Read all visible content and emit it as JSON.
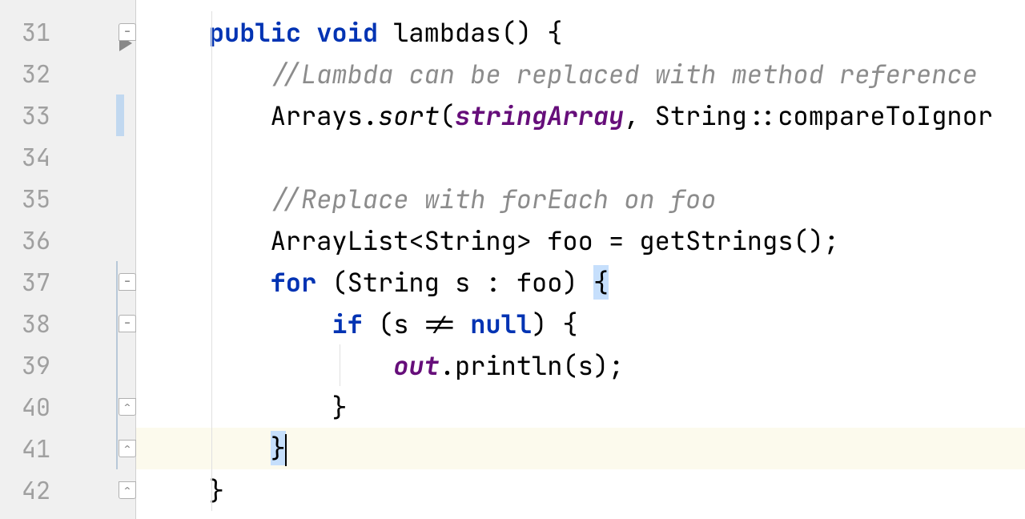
{
  "editor": {
    "startLine": 31,
    "currentLine": 41,
    "lines": [
      {
        "num": 31,
        "foldTop": true,
        "runMarker": true,
        "indent": "    ",
        "tokens": [
          {
            "t": "public",
            "c": "kw"
          },
          {
            "t": " ",
            "c": ""
          },
          {
            "t": "void",
            "c": "kw"
          },
          {
            "t": " ",
            "c": ""
          },
          {
            "t": "lambdas",
            "c": "method-decl"
          },
          {
            "t": "() {",
            "c": "paren"
          }
        ]
      },
      {
        "num": 32,
        "indent": "        ",
        "tokens": [
          {
            "t": "//Lambda can be replaced with method reference",
            "c": "comment"
          }
        ]
      },
      {
        "num": 33,
        "changeMarker": true,
        "indent": "        ",
        "tokens": [
          {
            "t": "Arrays.",
            "c": "ident"
          },
          {
            "t": "sort",
            "c": "static-method"
          },
          {
            "t": "(",
            "c": "paren"
          },
          {
            "t": "stringArray",
            "c": "field"
          },
          {
            "t": ", String::compareToIgnor",
            "c": "ident"
          }
        ]
      },
      {
        "num": 34,
        "indent": "",
        "tokens": []
      },
      {
        "num": 35,
        "indent": "        ",
        "tokens": [
          {
            "t": "//Replace with forEach on foo",
            "c": "comment"
          }
        ]
      },
      {
        "num": 36,
        "indent": "        ",
        "tokens": [
          {
            "t": "ArrayList<String> foo = getStrings();",
            "c": "ident"
          }
        ]
      },
      {
        "num": 37,
        "foldTop": true,
        "vline": true,
        "indent": "        ",
        "tokens": [
          {
            "t": "for",
            "c": "kw"
          },
          {
            "t": " (String s : foo) ",
            "c": "ident"
          },
          {
            "t": "{",
            "c": "highlight-brace"
          }
        ]
      },
      {
        "num": 38,
        "foldTop": true,
        "vline": true,
        "indent": "            ",
        "tokens": [
          {
            "t": "if",
            "c": "kw"
          },
          {
            "t": " (s != ",
            "c": "ident"
          },
          {
            "t": "null",
            "c": "kw"
          },
          {
            "t": ") {",
            "c": "ident"
          }
        ]
      },
      {
        "num": 39,
        "vline": true,
        "indent": "                ",
        "tokens": [
          {
            "t": "out",
            "c": "field"
          },
          {
            "t": ".println(s);",
            "c": "ident"
          }
        ]
      },
      {
        "num": 40,
        "foldBottom": true,
        "vline": true,
        "indent": "            ",
        "tokens": [
          {
            "t": "}",
            "c": "ident"
          }
        ]
      },
      {
        "num": 41,
        "foldBottom": true,
        "vline": true,
        "current": true,
        "indent": "        ",
        "tokens": [
          {
            "t": "}",
            "c": "highlight-brace"
          }
        ],
        "cursor": true
      },
      {
        "num": 42,
        "foldBottom": true,
        "indent": "    ",
        "tokens": [
          {
            "t": "}",
            "c": "ident"
          }
        ]
      }
    ]
  }
}
